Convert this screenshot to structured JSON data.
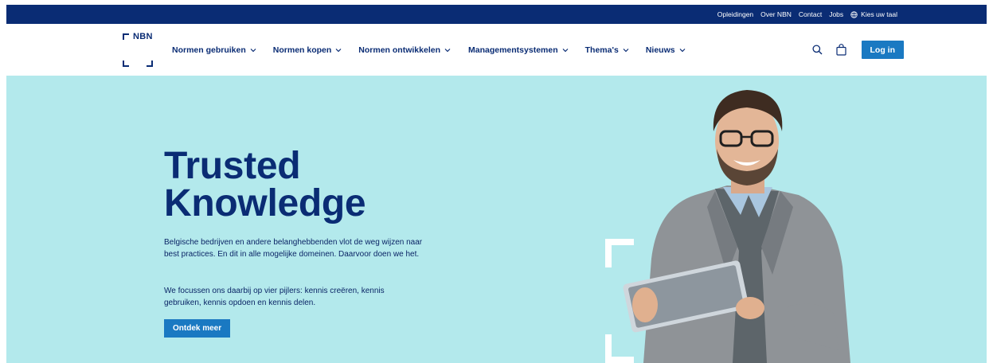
{
  "topbar": {
    "links": [
      "Opleidingen",
      "Over NBN",
      "Contact",
      "Jobs"
    ],
    "language_label": "Kies uw taal"
  },
  "header": {
    "logo_text": "NBN",
    "nav": [
      {
        "label": "Normen gebruiken"
      },
      {
        "label": "Normen kopen"
      },
      {
        "label": "Normen ontwikkelen"
      },
      {
        "label": "Managementsystemen"
      },
      {
        "label": "Thema's"
      },
      {
        "label": "Nieuws"
      }
    ],
    "login_label": "Log in",
    "icons": [
      "search-icon",
      "shopping-bag-icon",
      "globe-icon",
      "chevron-down-icon"
    ]
  },
  "hero": {
    "title_line1": "Trusted",
    "title_line2": "Knowledge",
    "paragraph1": "Belgische bedrijven en andere belanghebbenden vlot de weg wijzen naar best practices. En dit in alle mogelijke domeinen. Daarvoor doen we het.",
    "paragraph2": "We focussen ons daarbij op vier pijlers: kennis creëren, kennis gebruiken, kennis opdoen en kennis delen.",
    "cta_label": "Ontdek meer"
  },
  "colors": {
    "navy": "#0a2c74",
    "accent_blue": "#1a79c2",
    "hero_bg": "#b3e9ec",
    "white": "#ffffff"
  }
}
